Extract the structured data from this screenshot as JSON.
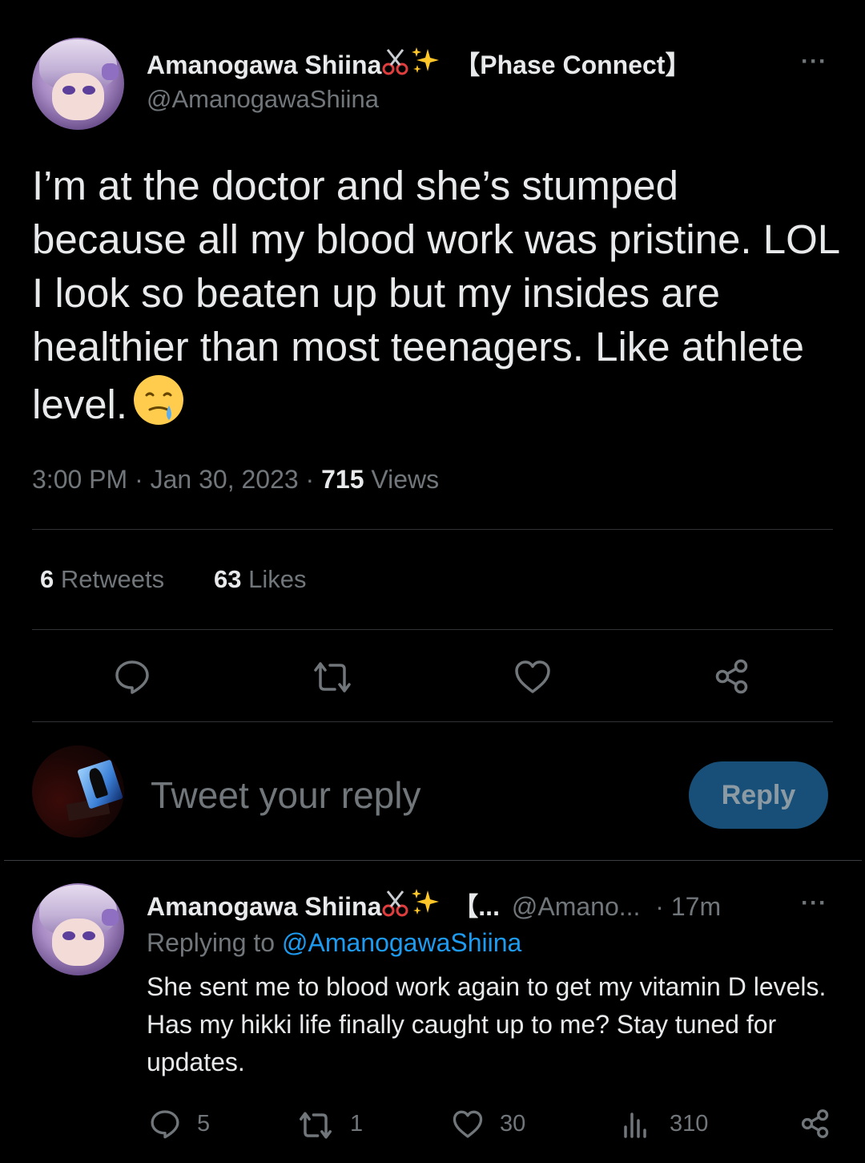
{
  "main_tweet": {
    "author": {
      "display_name": "Amanogawa Shiina",
      "affiliation": "【Phase Connect】",
      "handle": "@AmanogawaShiina",
      "name_emojis": [
        "scissors-emoji",
        "sparkles-emoji"
      ]
    },
    "text": "I’m at the doctor and she’s stumped because all my blood work was pristine. LOL I look so beaten up but my insides are healthier than most teenagers. Like athlete level.",
    "text_emoji": "face-holding-back-tears-emoji",
    "time": "3:00 PM",
    "date": "Jan 30, 2023",
    "views_count": "715",
    "views_label": "Views",
    "retweets_count": "6",
    "retweets_label": "Retweets",
    "likes_count": "63",
    "likes_label": "Likes",
    "more_label": "···",
    "actions": [
      "reply-icon",
      "retweet-icon",
      "like-icon",
      "share-icon"
    ]
  },
  "composer": {
    "placeholder": "Tweet your reply",
    "button_label": "Reply"
  },
  "reply_tweet": {
    "display_name": "Amanogawa Shiina",
    "affiliation_truncated": "【...",
    "handle_truncated": "@Amano...",
    "time_ago": "· 17m",
    "replying_prefix": "Replying to",
    "replying_to": "@AmanogawaShiina",
    "text": "She sent me to blood work again to get my vitamin D levels. Has my hikki life finally caught up to me? Stay tuned for updates.",
    "more_label": "···",
    "reply_count": "5",
    "retweet_count": "1",
    "like_count": "30",
    "views_count": "310"
  },
  "colors": {
    "background": "#000000",
    "text_primary": "#e7e9ea",
    "text_secondary": "#71767b",
    "link": "#1d9bf0",
    "divider": "#2f3336",
    "reply_button_bg": "#174f78"
  }
}
